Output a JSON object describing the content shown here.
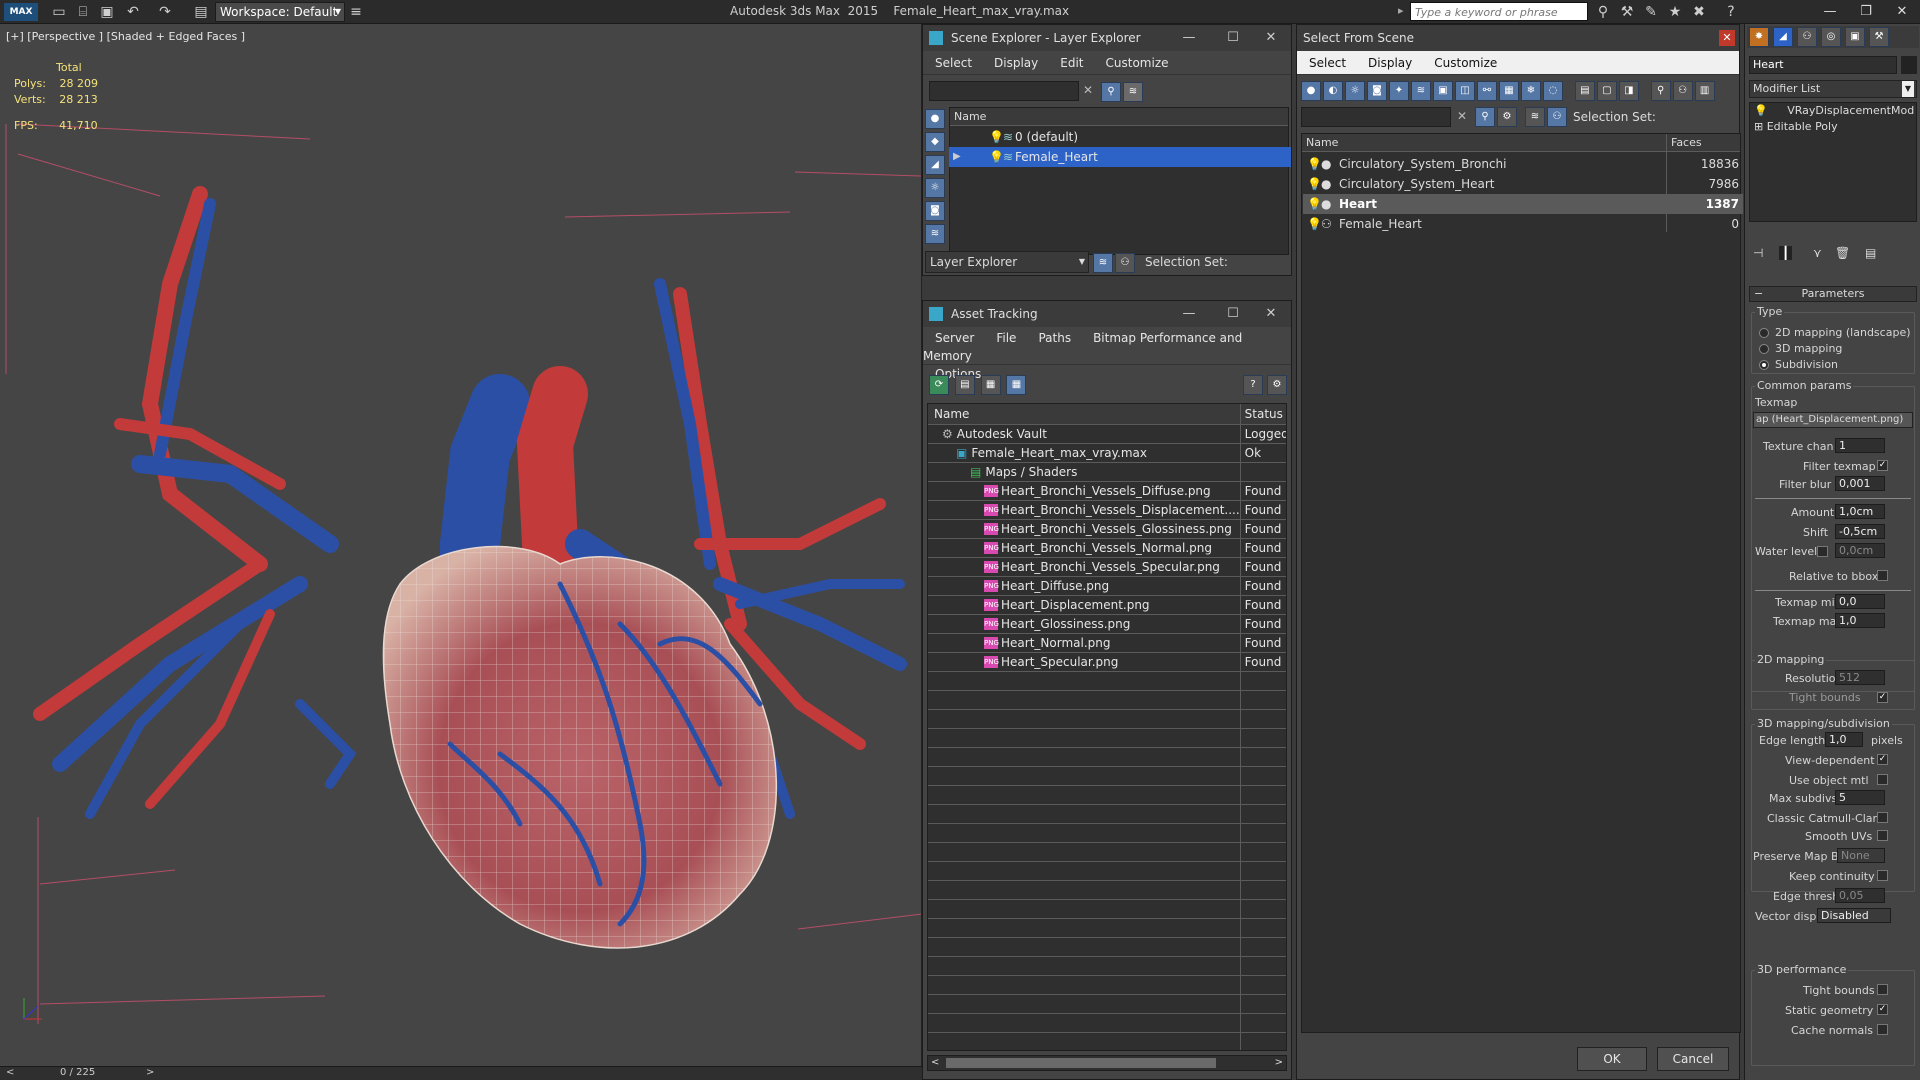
{
  "app": {
    "workspace": "Workspace: Default",
    "title": "Autodesk 3ds Max  2015    Female_Heart_max_vray.max",
    "search_placeholder": "Type a keyword or phrase"
  },
  "viewport": {
    "label": "[+] [Perspective ] [Shaded + Edged Faces ]",
    "stats_total": "Total",
    "polys_label": "Polys:",
    "polys_value": "28 209",
    "verts_label": "Verts:",
    "verts_value": "28 213",
    "fps_label": "FPS:",
    "fps_value": "41,710",
    "timeline": "0 / 225"
  },
  "scene_explorer": {
    "title": "Scene Explorer - Layer Explorer",
    "menus": [
      "Select",
      "Display",
      "Edit",
      "Customize"
    ],
    "column": "Name",
    "rows": [
      {
        "label": "0 (default)",
        "selected": false
      },
      {
        "label": "Female_Heart",
        "selected": true
      }
    ],
    "footer_dropdown": "Layer Explorer",
    "selection_set": "Selection Set:"
  },
  "asset_tracking": {
    "title": "Asset Tracking",
    "menus": [
      "Server",
      "File",
      "Paths",
      "Bitmap Performance and Memory"
    ],
    "menus2": [
      "Options"
    ],
    "col_name": "Name",
    "col_status": "Status",
    "rows": [
      {
        "name": "Autodesk Vault",
        "status": "Logged Ou",
        "indent": 1,
        "kind": "vault"
      },
      {
        "name": "Female_Heart_max_vray.max",
        "status": "Ok",
        "indent": 2,
        "kind": "max"
      },
      {
        "name": "Maps / Shaders",
        "status": "",
        "indent": 3,
        "kind": "folder"
      },
      {
        "name": "Heart_Bronchi_Vessels_Diffuse.png",
        "status": "Found",
        "indent": 4,
        "kind": "png"
      },
      {
        "name": "Heart_Bronchi_Vessels_Displacement....",
        "status": "Found",
        "indent": 4,
        "kind": "png"
      },
      {
        "name": "Heart_Bronchi_Vessels_Glossiness.png",
        "status": "Found",
        "indent": 4,
        "kind": "png"
      },
      {
        "name": "Heart_Bronchi_Vessels_Normal.png",
        "status": "Found",
        "indent": 4,
        "kind": "png"
      },
      {
        "name": "Heart_Bronchi_Vessels_Specular.png",
        "status": "Found",
        "indent": 4,
        "kind": "png"
      },
      {
        "name": "Heart_Diffuse.png",
        "status": "Found",
        "indent": 4,
        "kind": "png"
      },
      {
        "name": "Heart_Displacement.png",
        "status": "Found",
        "indent": 4,
        "kind": "png"
      },
      {
        "name": "Heart_Glossiness.png",
        "status": "Found",
        "indent": 4,
        "kind": "png"
      },
      {
        "name": "Heart_Normal.png",
        "status": "Found",
        "indent": 4,
        "kind": "png"
      },
      {
        "name": "Heart_Specular.png",
        "status": "Found",
        "indent": 4,
        "kind": "png"
      }
    ],
    "png_badge": "PNG"
  },
  "select_from_scene": {
    "title": "Select From Scene",
    "menus": [
      "Select",
      "Display",
      "Customize"
    ],
    "selection_set": "Selection Set:",
    "col_name": "Name",
    "col_faces": "Faces",
    "rows": [
      {
        "name": "Circulatory_System_Bronchi",
        "faces": "18836",
        "highlight": false
      },
      {
        "name": "Circulatory_System_Heart",
        "faces": "7986",
        "highlight": false
      },
      {
        "name": "Heart",
        "faces": "1387",
        "highlight": true
      },
      {
        "name": "Female_Heart",
        "faces": "0",
        "highlight": false
      }
    ],
    "ok": "OK",
    "cancel": "Cancel"
  },
  "command_panel": {
    "object_name": "Heart",
    "modifier_list": "Modifier List",
    "stack": [
      "VRayDisplacementMod",
      "Editable Poly"
    ],
    "rollout": "Parameters",
    "type_group": "Type",
    "type_options": [
      "2D mapping (landscape)",
      "3D mapping",
      "Subdivision"
    ],
    "common_group": "Common params",
    "texmap_label": "Texmap",
    "texmap_value": "ap (Heart_Displacement.png)",
    "texture_chan_label": "Texture chan",
    "texture_chan_value": "1",
    "filter_texmap": "Filter texmap",
    "filter_blur_label": "Filter blur",
    "filter_blur_value": "0,001",
    "amount_label": "Amount",
    "amount_value": "1,0cm",
    "shift_label": "Shift",
    "shift_value": "-0,5cm",
    "water_level_label": "Water level",
    "water_level_value": "0,0cm",
    "relative_bbox": "Relative to bbox",
    "texmap_min_label": "Texmap min",
    "texmap_min_value": "0,0",
    "texmap_max_label": "Texmap max",
    "texmap_max_value": "1,0",
    "map2d_group": "2D mapping",
    "resolution_label": "Resolution",
    "resolution_value": "512",
    "tight_bounds": "Tight bounds",
    "map3d_group": "3D mapping/subdivision",
    "edge_length_label": "Edge length",
    "edge_length_value": "1,0",
    "pixels": "pixels",
    "view_dependent": "View-dependent",
    "use_object_mtl": "Use object mtl",
    "max_subdivs_label": "Max subdivs",
    "max_subdivs_value": "5",
    "classic_catmull": "Classic Catmull-Clark",
    "smooth_uvs": "Smooth UVs",
    "preserve_map_label": "Preserve Map Bnd",
    "preserve_map_value": "None",
    "keep_continuity": "Keep continuity",
    "edge_thresh_label": "Edge thresh",
    "edge_thresh_value": "0,05",
    "vector_displ_label": "Vector displ",
    "vector_displ_value": "Disabled",
    "perf_group": "3D performance",
    "perf_tight_bounds": "Tight bounds",
    "static_geometry": "Static geometry",
    "cache_normals": "Cache normals",
    "checkmark": "✓"
  }
}
